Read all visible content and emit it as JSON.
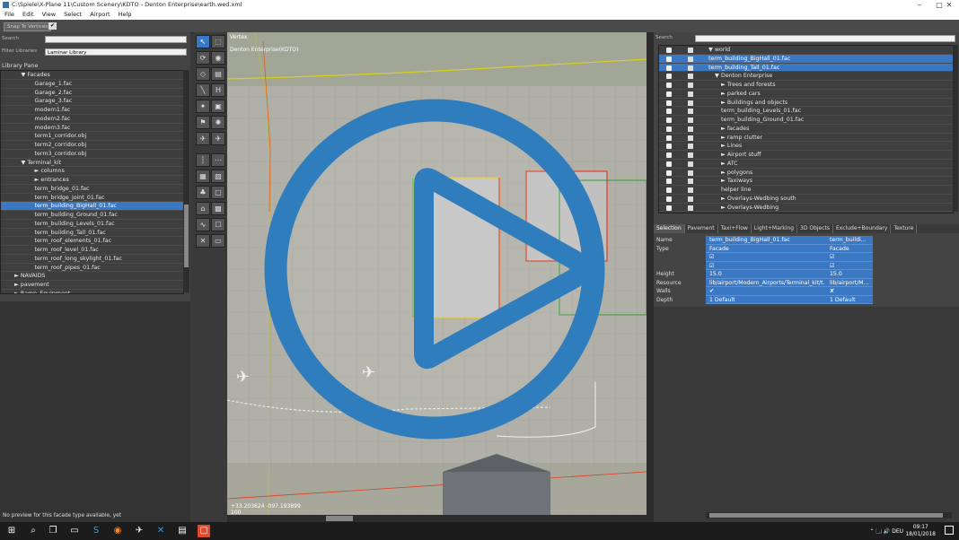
{
  "window": {
    "title": "C:\\Spiele\\X-Plane 11\\Custom Scenery\\KDTO - Denton Enterprise\\earth.wed.xml",
    "controls": [
      "–",
      "□",
      "✕"
    ]
  },
  "menu": [
    "File",
    "Edit",
    "View",
    "Select",
    "Airport",
    "Help"
  ],
  "toolbar": {
    "snap_label": "Snap To Vertices",
    "snap_checked": "✔"
  },
  "left": {
    "search_label": "Search",
    "search_value": "",
    "filter_label": "Filter Libraries",
    "filter_value": "Laminar Library",
    "pane_title": "Library Pane",
    "items": [
      {
        "indent": 3,
        "label": "▼ Facades",
        "sel": false
      },
      {
        "indent": 5,
        "label": "Garage_1.fac",
        "sel": false
      },
      {
        "indent": 5,
        "label": "Garage_2.fac",
        "sel": false
      },
      {
        "indent": 5,
        "label": "Garage_3.fac",
        "sel": false
      },
      {
        "indent": 5,
        "label": "modern1.fac",
        "sel": false
      },
      {
        "indent": 5,
        "label": "modern2.fac",
        "sel": false
      },
      {
        "indent": 5,
        "label": "modern3.fac",
        "sel": false
      },
      {
        "indent": 5,
        "label": "term1_corridor.obj",
        "sel": false
      },
      {
        "indent": 5,
        "label": "term2_corridor.obj",
        "sel": false
      },
      {
        "indent": 5,
        "label": "term3_corridor.obj",
        "sel": false
      },
      {
        "indent": 3,
        "label": "▼ Terminal_kit",
        "sel": false
      },
      {
        "indent": 5,
        "label": "► columns",
        "sel": false
      },
      {
        "indent": 5,
        "label": "► entrances",
        "sel": false
      },
      {
        "indent": 5,
        "label": "term_bridge_01.fac",
        "sel": false
      },
      {
        "indent": 5,
        "label": "term_bridge_joint_01.fac",
        "sel": false
      },
      {
        "indent": 5,
        "label": "term_building_BigHall_01.fac",
        "sel": true
      },
      {
        "indent": 5,
        "label": "term_building_Ground_01.fac",
        "sel": false
      },
      {
        "indent": 5,
        "label": "term_building_Levels_01.fac",
        "sel": false
      },
      {
        "indent": 5,
        "label": "term_building_Tall_01.fac",
        "sel": false
      },
      {
        "indent": 5,
        "label": "term_roof_elements_01.fac",
        "sel": false
      },
      {
        "indent": 5,
        "label": "term_roof_level_01.fac",
        "sel": false
      },
      {
        "indent": 5,
        "label": "term_roof_long_skylight_01.fac",
        "sel": false
      },
      {
        "indent": 5,
        "label": "term_roof_pipes_01.fac",
        "sel": false
      },
      {
        "indent": 2,
        "label": "► NAVAIDS",
        "sel": false
      },
      {
        "indent": 2,
        "label": "► pavement",
        "sel": false
      },
      {
        "indent": 2,
        "label": "► Ramp_Equipment",
        "sel": false
      }
    ],
    "preview_message": "No preview for this facade type available, yet"
  },
  "map": {
    "label_tool": "Vertex",
    "label_airport": "Denton Enterprise(KDTO)",
    "coords": "+33.203624 -097.193899",
    "scale": "100"
  },
  "right": {
    "search_label": "Search",
    "search_value": "",
    "hierarchy": [
      {
        "indent": 0,
        "label": "▼ world",
        "sel": false
      },
      {
        "indent": 0,
        "label": "term_building_BigHall_01.fac",
        "sel": true
      },
      {
        "indent": 0,
        "label": "term_building_Tall_01.fac",
        "sel": true
      },
      {
        "indent": 1,
        "label": "▼ Denton Enterprise",
        "sel": false
      },
      {
        "indent": 2,
        "label": "► Trees and forests",
        "sel": false
      },
      {
        "indent": 2,
        "label": "► parked cars",
        "sel": false
      },
      {
        "indent": 2,
        "label": "► Buildings and objects",
        "sel": false
      },
      {
        "indent": 2,
        "label": "term_building_Levels_01.fac",
        "sel": false
      },
      {
        "indent": 2,
        "label": "term_building_Ground_01.fac",
        "sel": false
      },
      {
        "indent": 2,
        "label": "► facades",
        "sel": false
      },
      {
        "indent": 2,
        "label": "► ramp clutter",
        "sel": false
      },
      {
        "indent": 2,
        "label": "► Lines",
        "sel": false
      },
      {
        "indent": 2,
        "label": "► Airport stuff",
        "sel": false
      },
      {
        "indent": 2,
        "label": "► ATC",
        "sel": false
      },
      {
        "indent": 2,
        "label": "► polygons",
        "sel": false
      },
      {
        "indent": 2,
        "label": "► Taxiways",
        "sel": false
      },
      {
        "indent": 2,
        "label": "helper line",
        "sel": false
      },
      {
        "indent": 2,
        "label": "► Overlays-Wedbing south",
        "sel": false
      },
      {
        "indent": 2,
        "label": "► Overlays-Wedbing",
        "sel": false
      }
    ],
    "tabs": [
      "Selection",
      "Pavement",
      "Taxi+Flow",
      "Light+Marking",
      "3D Objects",
      "Exclude+Boundary",
      "Texture"
    ],
    "prop_labels": [
      "Name",
      "Type",
      "",
      "",
      "Height",
      "Resource",
      "Walls",
      "Depth"
    ],
    "props": [
      {
        "c1": "term_building_BigHall_01.fac",
        "c2": "term_buildi..."
      },
      {
        "c1": "Facade",
        "c2": "Facade"
      },
      {
        "c1": "☑",
        "c2": "☑"
      },
      {
        "c1": "☑",
        "c2": "☑"
      },
      {
        "c1": "15.0",
        "c2": "15.0"
      },
      {
        "c1": "lib/airport/Modern_Airports/Terminal_kit/t...",
        "c2": "lib/airport/M..."
      },
      {
        "c1": "✔",
        "c2": "✘"
      },
      {
        "c1": "1 Default",
        "c2": "1 Default"
      }
    ]
  },
  "taskbar": {
    "time": "09:17",
    "date": "18/01/2018",
    "tray": "⌃ 🗔 🔊 DEU"
  },
  "colors": {
    "selection": "#3b78c4",
    "overlay_play": "#2f7dbc",
    "panel": "#444444"
  }
}
